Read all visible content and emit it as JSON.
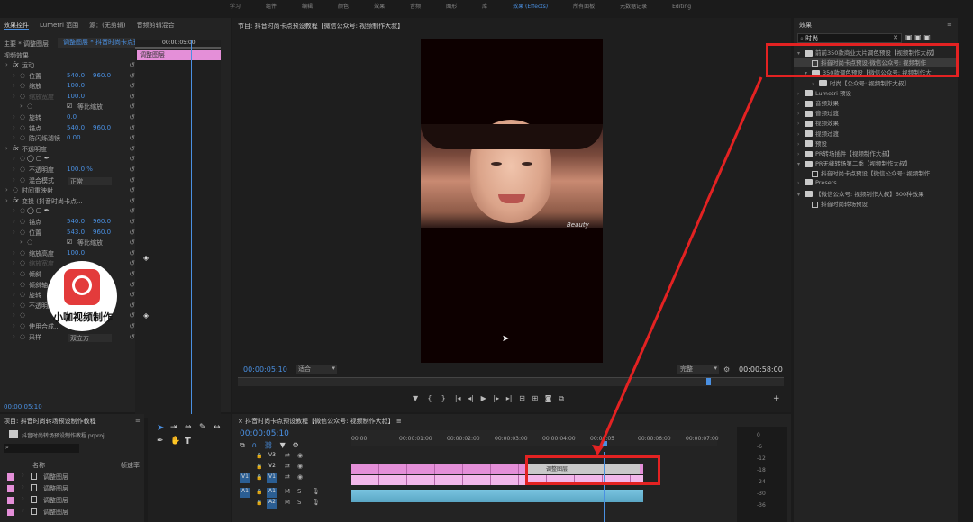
{
  "workspace_tabs": [
    "学习",
    "组件",
    "编辑",
    "颜色",
    "效果",
    "音频",
    "图形",
    "库",
    "效果 (Effects)",
    "所有面板",
    "元数据记录",
    "Editing"
  ],
  "effect_controls": {
    "tabs": [
      "效果控件",
      "Lumetri 范围",
      "源：(无剪辑)",
      "音频剪辑混合"
    ],
    "source_header": "主要 * 调整图层",
    "clip_name": "调整图层 * 抖音时尚卡点预...",
    "timecode_top": "00:00:05:00",
    "clip_label": "调整图层",
    "section_video": "视频效果",
    "rows": [
      {
        "label": "运动",
        "indent": 1,
        "fx": true
      },
      {
        "label": "位置",
        "v1": "540.0",
        "v2": "960.0",
        "indent": 2
      },
      {
        "label": "缩放",
        "v1": "100.0",
        "indent": 2
      },
      {
        "label": "缩放宽度",
        "v1": "100.0",
        "indent": 2,
        "dim": true
      },
      {
        "label": "等比缩放",
        "check": true,
        "indent": 3
      },
      {
        "label": "旋转",
        "v1": "0.0",
        "indent": 2
      },
      {
        "label": "锚点",
        "v1": "540.0",
        "v2": "960.0",
        "indent": 2
      },
      {
        "label": "防闪烁滤镜",
        "v1": "0.00",
        "indent": 2
      },
      {
        "label": "不透明度",
        "indent": 1,
        "fx": true
      },
      {
        "label": "",
        "shapes": true,
        "indent": 2
      },
      {
        "label": "不透明度",
        "v1": "100.0 %",
        "indent": 2
      },
      {
        "label": "混合模式",
        "select": "正常",
        "indent": 2
      },
      {
        "label": "时间重映射",
        "indent": 1
      },
      {
        "label": "变换 (抖音时尚卡点...",
        "indent": 1,
        "fx": true
      },
      {
        "label": "",
        "shapes": true,
        "indent": 2
      },
      {
        "label": "锚点",
        "v1": "540.0",
        "v2": "960.0",
        "indent": 2
      },
      {
        "label": "位置",
        "v1": "543.0",
        "v2": "960.0",
        "indent": 2
      },
      {
        "label": "等比缩放",
        "check": true,
        "indent": 3
      },
      {
        "label": "缩放高度",
        "v1": "100.0",
        "indent": 2
      },
      {
        "label": "缩放宽度",
        "indent": 2,
        "dim": true
      },
      {
        "label": "倾斜",
        "indent": 2
      },
      {
        "label": "倾斜轴",
        "indent": 2
      },
      {
        "label": "旋转",
        "indent": 2
      },
      {
        "label": "不透明度",
        "indent": 2
      },
      {
        "label": "",
        "indent": 2
      },
      {
        "label": "使用合成...",
        "indent": 2
      },
      {
        "label": "采样",
        "select": "双立方",
        "indent": 2
      }
    ],
    "timecode_bottom": "00:00:05:10"
  },
  "watermark_text": "小咖视频制作",
  "program": {
    "title": "节目: 抖音时尚卡点预设教程【微信公众号: 视频制作大叔】",
    "timecode": "00:00:05:10",
    "fit": "适合",
    "quality": "完整",
    "duration": "00:00:58:00",
    "signature": "Beauty"
  },
  "effects": {
    "title": "效果",
    "search_value": "时尚",
    "items": [
      {
        "type": "folder",
        "label": "前前350款商业大片调色预设【视频制作大叔】",
        "indent": 0,
        "open": true
      },
      {
        "type": "preset",
        "label": "抖音时尚卡点预设-微信公众号: 视频制作",
        "indent": 1,
        "selected": true
      },
      {
        "type": "folder",
        "label": "350款调色预设【微信公众号: 视频制作大",
        "indent": 1,
        "open": true
      },
      {
        "type": "folder",
        "label": "时尚【公众号: 视频制作大叔】",
        "indent": 2
      },
      {
        "type": "folder",
        "label": "Lumetri 预设",
        "indent": 0
      },
      {
        "type": "folder",
        "label": "音频效果",
        "indent": 0
      },
      {
        "type": "folder",
        "label": "音频过渡",
        "indent": 0
      },
      {
        "type": "folder",
        "label": "视频效果",
        "indent": 0
      },
      {
        "type": "folder",
        "label": "视频过渡",
        "indent": 0
      },
      {
        "type": "folder",
        "label": "预设",
        "indent": 0
      },
      {
        "type": "folder",
        "label": "PR转场插件【视频制作大叔】",
        "indent": 0
      },
      {
        "type": "folder",
        "label": "PR无缝转场第二季【视频制作大叔】",
        "indent": 0,
        "open": true
      },
      {
        "type": "preset",
        "label": "抖音时尚卡点预设【微信公众号: 视频制作",
        "indent": 1
      },
      {
        "type": "folder",
        "label": "Presets",
        "indent": 0
      },
      {
        "type": "folder",
        "label": "【微信公众号: 视频制作大叔】600种效果",
        "indent": 0,
        "open": true
      },
      {
        "type": "preset",
        "label": "抖音时尚转场预设",
        "indent": 1
      }
    ]
  },
  "project": {
    "title": "项目: 抖音时尚转场预设制作教程",
    "file": "抖音时尚转场预设制作教程.prproj",
    "col_name": "名称",
    "col_rate": "帧速率",
    "items": [
      "调整图层",
      "调整图层",
      "调整图层",
      "调整图层"
    ]
  },
  "timeline": {
    "title": "抖音时尚卡点预设教程【微信公众号: 视频制作大叔】",
    "timecode": "00:00:05:10",
    "ruler": [
      "00:00",
      "00:00:01:00",
      "00:00:02:00",
      "00:00:03:00",
      "00:00:04:00",
      "00:00:05",
      "00:00:06:00",
      "00:00:07:00"
    ],
    "tracks": [
      "V3",
      "V2",
      "V1",
      "A1",
      "A2"
    ],
    "src_v": "V1",
    "src_a": "A1",
    "clip_adjust": "调整图层",
    "clip_name": "fx",
    "meter_labels": [
      "0",
      "-6",
      "-12",
      "-18",
      "-24",
      "-30",
      "-36"
    ]
  },
  "colors": {
    "accent": "#4a90e2",
    "playhead": "#4a90e2",
    "clip_pink": "#e48fd8",
    "highlight": "#e32222",
    "audio": "#79c4e0"
  }
}
